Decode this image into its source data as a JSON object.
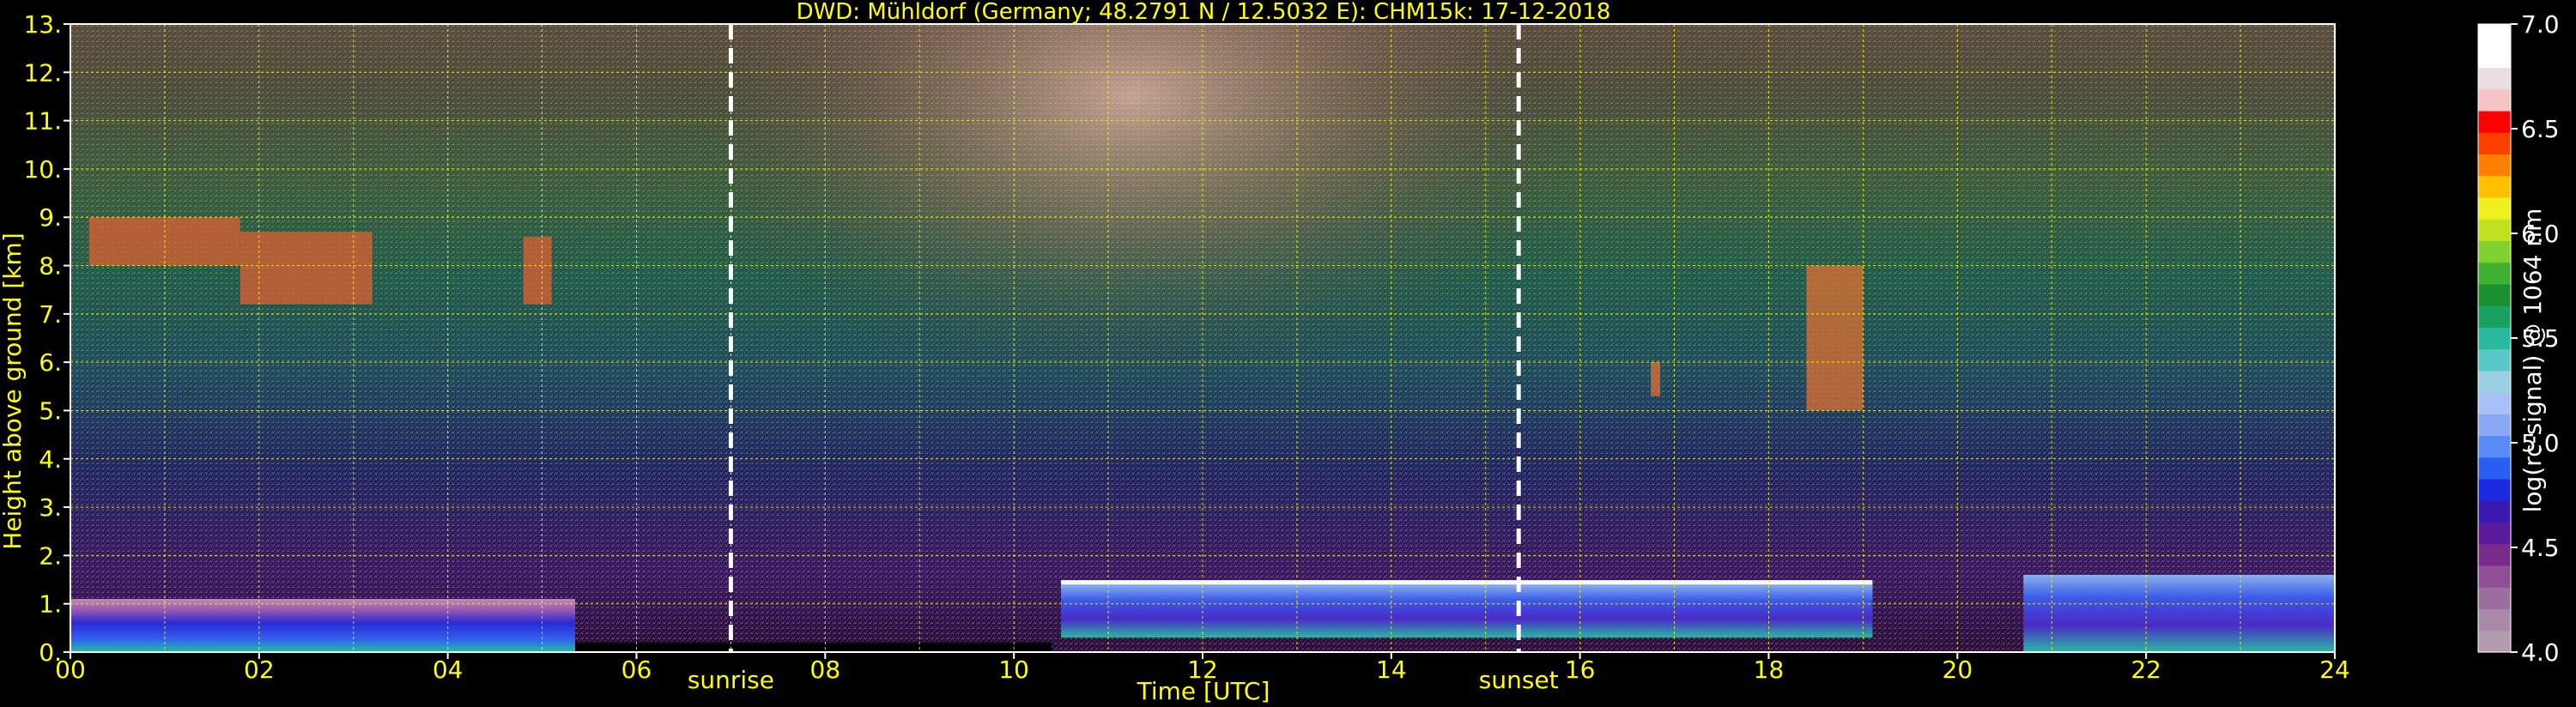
{
  "chart_data": {
    "type": "heatmap",
    "title": "DWD: Mühldorf (Germany; 48.2791 N / 12.5032 E):    CHM15k: 17-12-2018",
    "xlabel": "Time [UTC]",
    "ylabel": "Height above ground [km]",
    "xlim": [
      0,
      24
    ],
    "ylim": [
      0,
      13
    ],
    "x_ticks": [
      "00",
      "02",
      "04",
      "06",
      "08",
      "10",
      "12",
      "14",
      "16",
      "18",
      "20",
      "22",
      "24"
    ],
    "y_ticks": [
      "0.",
      "1.",
      "2.",
      "3.",
      "4.",
      "5.",
      "6.",
      "7.",
      "8.",
      "9.",
      "10.",
      "11.",
      "12.",
      "13."
    ],
    "grid": true,
    "grid_color": "#ffff00",
    "label_color": "#ffff00",
    "background": "#000000",
    "annotations": [
      {
        "label": "sunrise",
        "x": 7.0
      },
      {
        "label": "sunset",
        "x": 15.35
      }
    ],
    "colorbar": {
      "label": "log(rc-signal) @ 1064 nm",
      "min": 4.0,
      "max": 7.0,
      "tick_labels": [
        "4.0",
        "4.5",
        "5.0",
        "5.5",
        "6.0",
        "6.5",
        "7.0"
      ],
      "colors": [
        "#b39bb0",
        "#a98aa8",
        "#9d6fa0",
        "#8f4f94",
        "#7a2a8a",
        "#5a1a9a",
        "#3a1ab0",
        "#1a2ae0",
        "#2a5ef0",
        "#5a8af5",
        "#8aa8f5",
        "#a8c0f5",
        "#9ad0e0",
        "#5ac8c8",
        "#2ab8a0",
        "#1aa060",
        "#1a9030",
        "#40b030",
        "#80d030",
        "#c0e020",
        "#f0f020",
        "#ffc000",
        "#ff8000",
        "#ff4000",
        "#ff0000",
        "#f4c4c4",
        "#eadede",
        "#ffffff",
        "#ffffff"
      ]
    },
    "series": [
      {
        "type": "boundary_layer",
        "x_start": 0.0,
        "x_end": 5.35,
        "y_bottom": 0.0,
        "y_top": 1.1
      },
      {
        "type": "low_signal_gap",
        "x_start": 5.35,
        "x_end": 10.4,
        "y_bottom": 0.0,
        "y_top": 0.2
      },
      {
        "type": "cloud_top",
        "x_start": 10.5,
        "x_end": 19.1,
        "y": 1.4
      },
      {
        "type": "cloud_base_layer",
        "x_start": 10.5,
        "x_end": 19.1,
        "y_bottom": 0.3,
        "y_top": 1.4
      },
      {
        "type": "high_cloud",
        "x_start": 0.2,
        "x_end": 1.8,
        "y_bottom": 8.0,
        "y_top": 9.0
      },
      {
        "type": "high_cloud",
        "x_start": 1.8,
        "x_end": 3.2,
        "y_bottom": 7.2,
        "y_top": 8.7
      },
      {
        "type": "high_cloud",
        "x_start": 4.8,
        "x_end": 5.1,
        "y_bottom": 7.2,
        "y_top": 8.6
      },
      {
        "type": "mid_cloud",
        "x_start": 18.4,
        "x_end": 19.0,
        "y_bottom": 5.0,
        "y_top": 8.0
      },
      {
        "type": "mid_cloud",
        "x_start": 16.75,
        "x_end": 16.85,
        "y_bottom": 5.3,
        "y_top": 6.0
      },
      {
        "type": "evening_bl",
        "x_start": 20.7,
        "x_end": 24.0,
        "y_bottom": 0.0,
        "y_top": 1.6
      }
    ]
  }
}
